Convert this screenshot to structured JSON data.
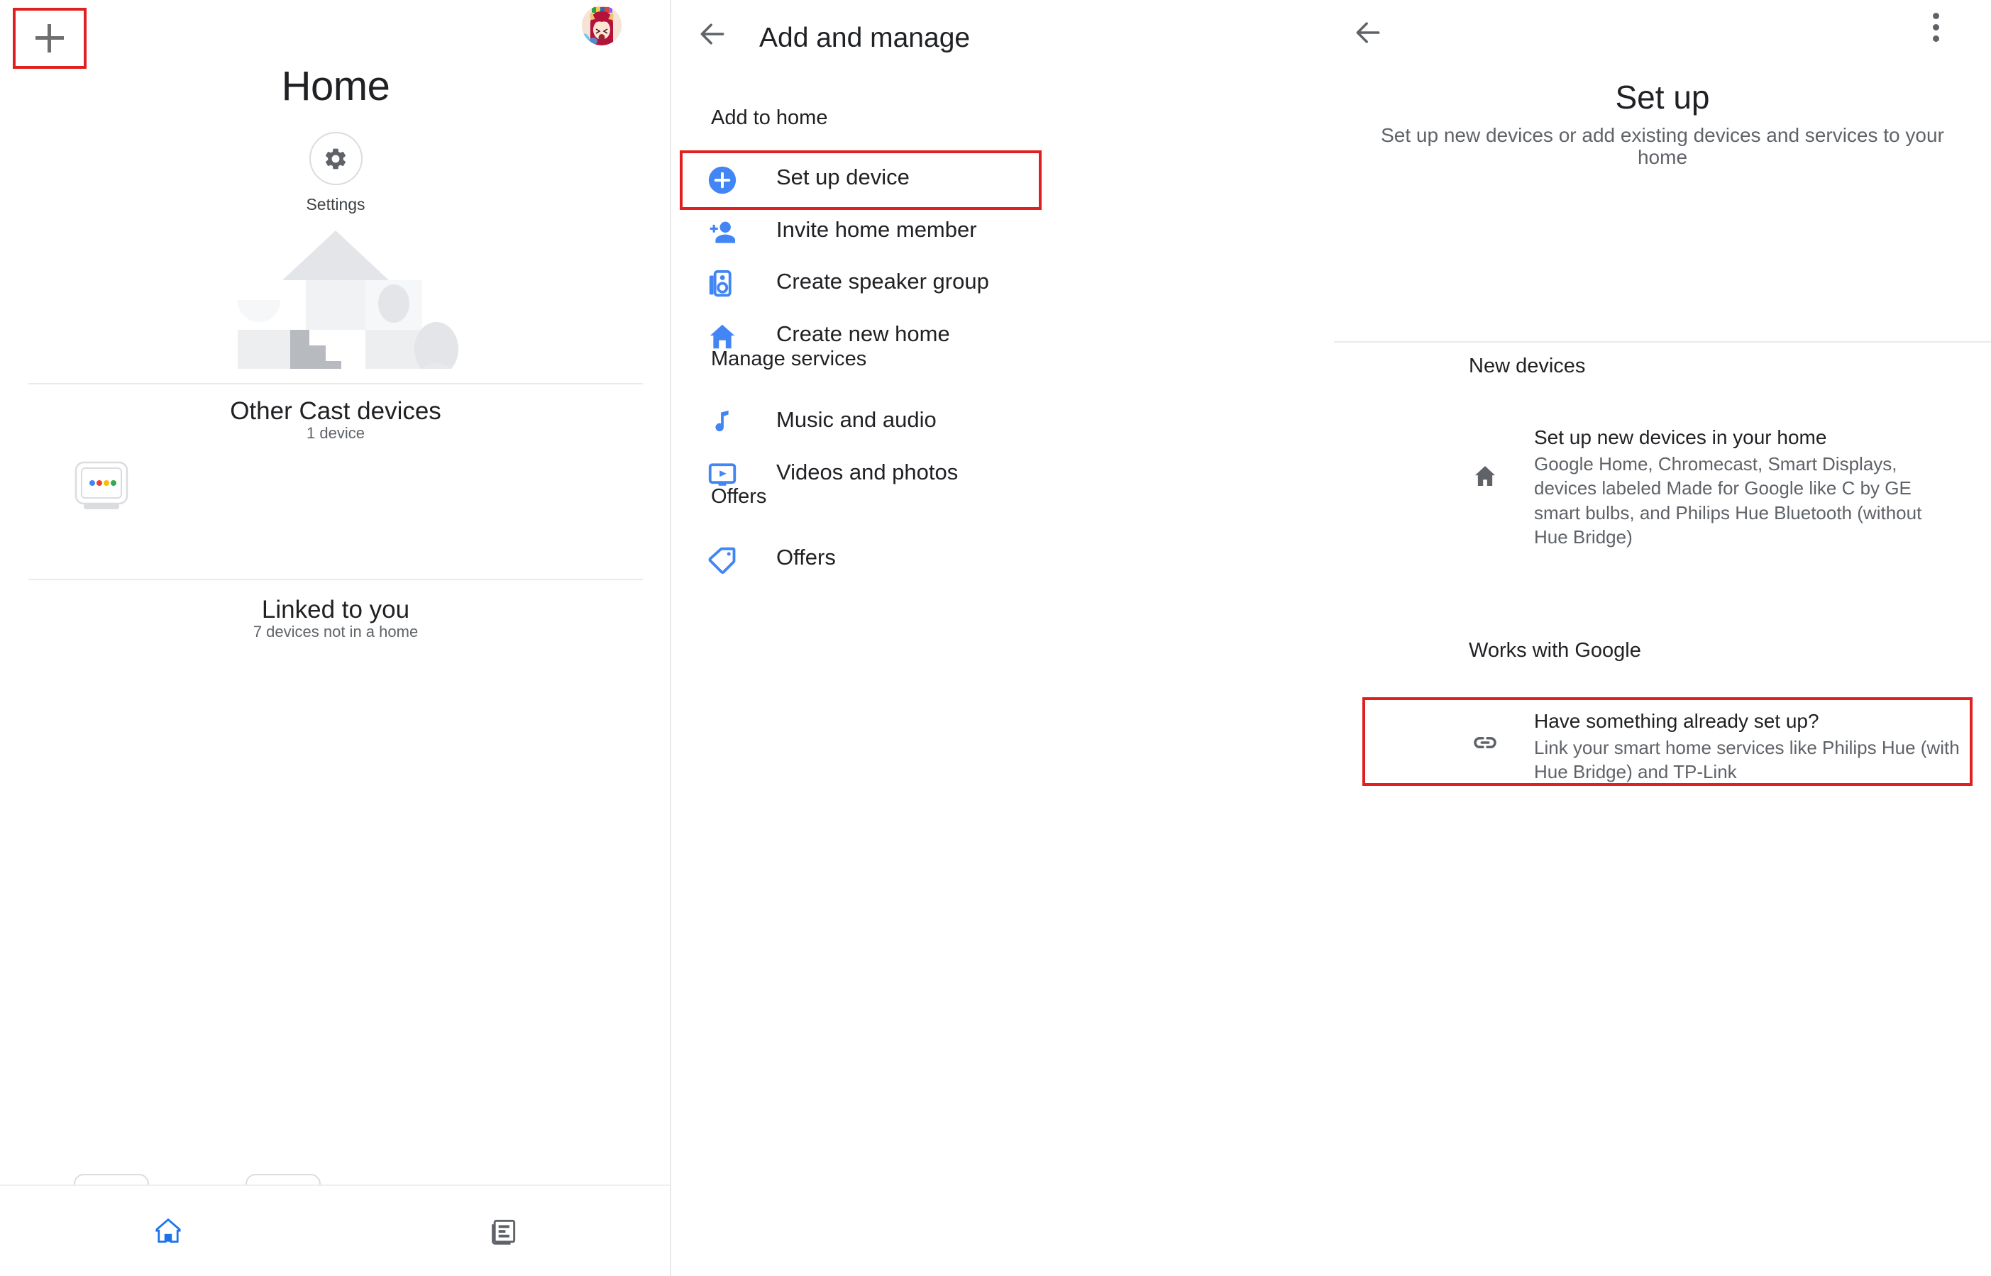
{
  "left_panel": {
    "add_icon": "plus-icon",
    "avatar_name": "user-avatar",
    "title": "Home",
    "settings_label": "Settings",
    "settings_icon": "gear-icon",
    "house_illustration": "house-illustration",
    "sections": [
      {
        "title": "Other Cast devices",
        "subtitle": "1 device"
      },
      {
        "title": "Linked to you",
        "subtitle": "7 devices not in a home"
      }
    ],
    "bottom_nav": [
      {
        "name": "home-tab",
        "icon": "home-icon",
        "active": true
      },
      {
        "name": "feed-tab",
        "icon": "feed-icon",
        "active": false
      }
    ]
  },
  "mid_panel": {
    "back_icon": "back-arrow-icon",
    "title": "Add and manage",
    "overflow_icon": "kebab-menu-icon",
    "groups": [
      {
        "header": "Add to home",
        "items": [
          {
            "label": "Set up device",
            "icon": "plus-circle-icon",
            "highlighted": true
          },
          {
            "label": "Invite home member",
            "icon": "person-add-icon",
            "highlighted": false
          },
          {
            "label": "Create speaker group",
            "icon": "speaker-group-icon",
            "highlighted": false
          },
          {
            "label": "Create new home",
            "icon": "home-icon",
            "highlighted": false
          }
        ]
      },
      {
        "header": "Manage services",
        "items": [
          {
            "label": "Music and audio",
            "icon": "music-note-icon",
            "highlighted": false
          },
          {
            "label": "Videos and photos",
            "icon": "video-play-icon",
            "highlighted": false
          }
        ]
      },
      {
        "header": "Offers",
        "items": [
          {
            "label": "Offers",
            "icon": "tag-icon",
            "highlighted": false
          }
        ]
      }
    ]
  },
  "right_panel": {
    "back_icon": "back-arrow-icon",
    "overflow_icon": "kebab-menu-icon",
    "title": "Set up",
    "subtitle": "Set up new devices or add existing devices and services to your home",
    "groups": [
      {
        "header": "New devices",
        "rows": [
          {
            "icon": "home-outline-icon",
            "title": "Set up new devices in your home",
            "desc": "Google Home, Chromecast, Smart Displays, devices labeled Made for Google like C by GE smart bulbs, and Philips Hue Bluetooth (without Hue Bridge)",
            "highlighted": false
          }
        ]
      },
      {
        "header": "Works with Google",
        "rows": [
          {
            "icon": "link-icon",
            "title": "Have something already set up?",
            "desc": "Link your smart home services like Philips Hue (with Hue Bridge) and TP-Link",
            "highlighted": true
          }
        ]
      }
    ]
  },
  "colors": {
    "accent_blue": "#4285f4",
    "highlight_red": "#e02020",
    "text_primary": "#202124",
    "text_secondary": "#5f6368",
    "divider": "#e8eaed"
  }
}
